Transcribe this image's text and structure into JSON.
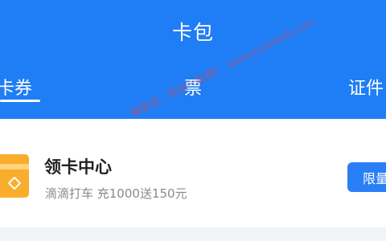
{
  "header": {
    "title": "卡包",
    "background_color": "#1f7df5"
  },
  "tabs": [
    {
      "label": "卡券",
      "active": true
    },
    {
      "label": "票",
      "active": false
    },
    {
      "label": "证件",
      "active": false
    }
  ],
  "card": {
    "icon": "card-icon",
    "title": "领卡中心",
    "subtitle": "滴滴打车 充1000送150元",
    "button_label": "限量",
    "accent_color": "#2b7ff6",
    "icon_color": "#f9ad2c"
  },
  "watermark": {
    "text": "赚客吧，有奖一起赚！ www.zuanke8.com"
  }
}
